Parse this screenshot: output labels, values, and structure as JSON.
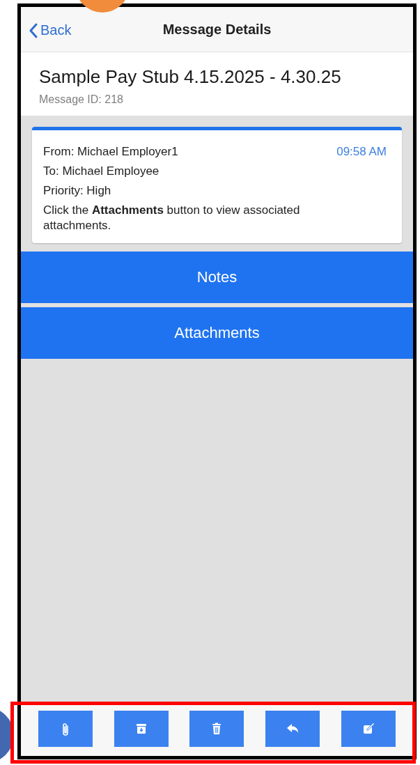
{
  "nav": {
    "back": "Back",
    "title": "Message Details"
  },
  "message": {
    "subject": "Sample Pay Stub 4.15.2025 - 4.30.25",
    "id_line": "Message ID: 218"
  },
  "card": {
    "from": "From: Michael Employer1",
    "time": "09:58 AM",
    "to": "To: Michael Employee",
    "priority": "Priority: High",
    "note": "Click the **Attachments** button to view associated attachments."
  },
  "actions": [
    "Notes",
    "Attachments"
  ],
  "toolbar": [
    {
      "kind": "attach"
    },
    {
      "kind": "archive"
    },
    {
      "kind": "delete"
    },
    {
      "kind": "reply"
    },
    {
      "kind": "compose"
    }
  ]
}
